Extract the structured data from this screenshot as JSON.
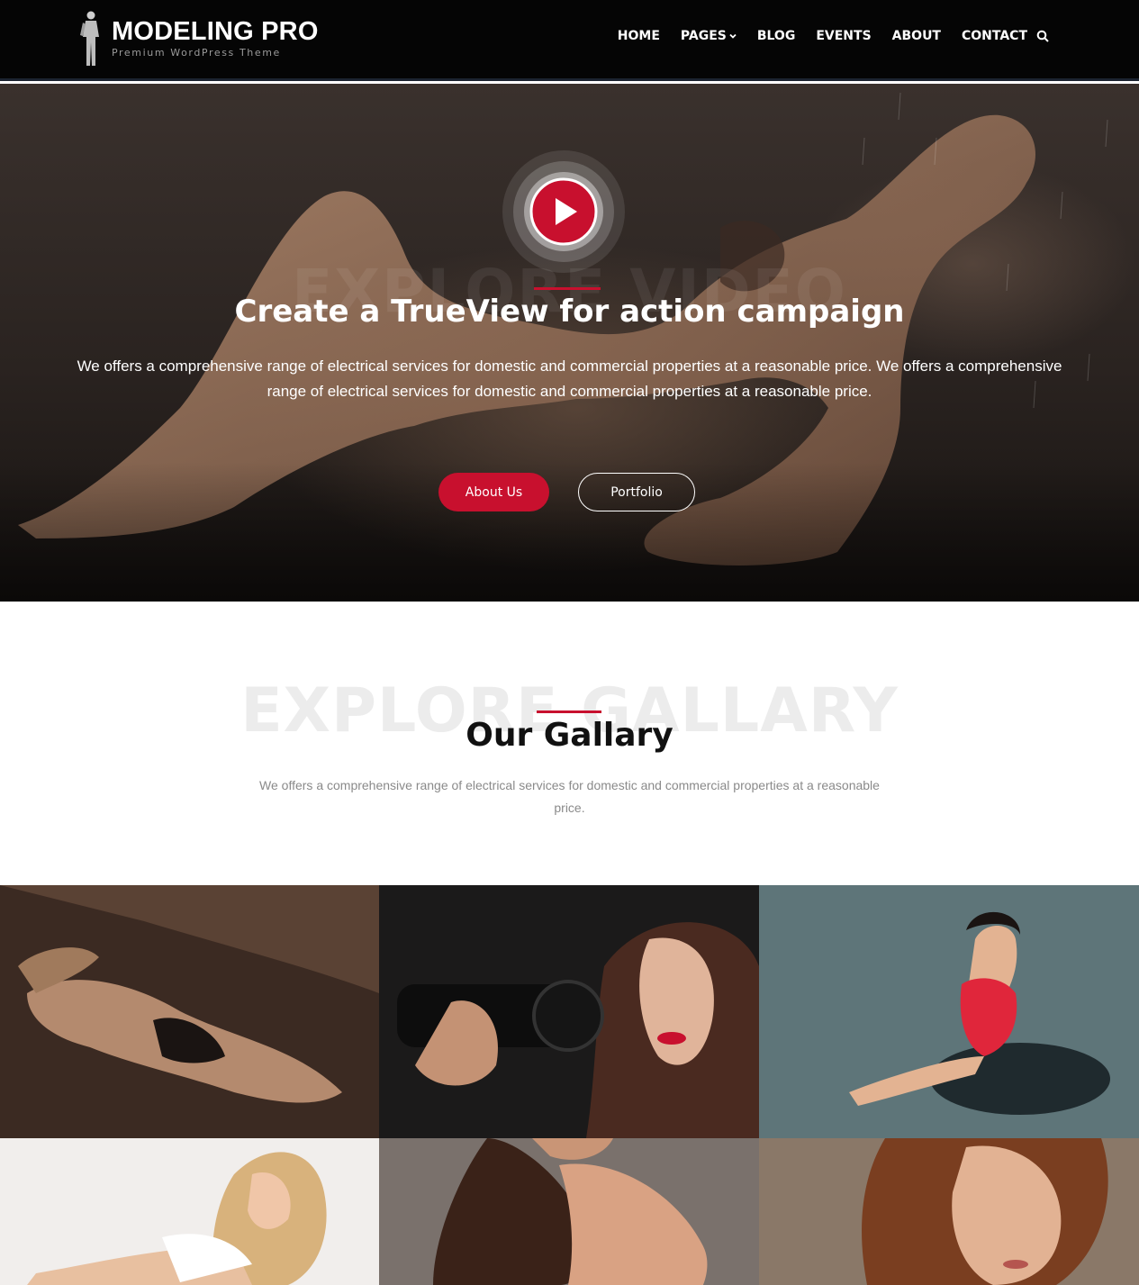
{
  "brand": {
    "title": "MODELING PRO",
    "subtitle": "Premium WordPress Theme"
  },
  "nav": {
    "items": [
      {
        "label": "HOME"
      },
      {
        "label": "PAGES",
        "has_dropdown": true
      },
      {
        "label": "BLOG"
      },
      {
        "label": "EVENTS"
      },
      {
        "label": "ABOUT"
      },
      {
        "label": "CONTACT"
      }
    ],
    "search_icon": "search-icon"
  },
  "hero": {
    "background_word": "EXPLORE VIDEO",
    "title": "Create a TrueView for action campaign",
    "text": "We offers a comprehensive range of electrical services for domestic and commercial properties at a reasonable price. We offers a comprehensive range of electrical services for domestic and commercial properties at a reasonable price.",
    "play_icon": "play-icon",
    "buttons": {
      "primary": "About Us",
      "secondary": "Portfolio"
    }
  },
  "gallery": {
    "background_word": "EXPLORE GALLARY",
    "title": "Our Gallary",
    "text": "We offers a comprehensive range of electrical services for domestic and commercial properties at a reasonable price.",
    "images": [
      "gallery-image-1",
      "gallery-image-2",
      "gallery-image-3",
      "gallery-image-4",
      "gallery-image-5",
      "gallery-image-6"
    ]
  },
  "colors": {
    "accent": "#c8102e",
    "header_bg": "#050505",
    "heading": "#111111",
    "body_text": "#8a8a8a"
  }
}
